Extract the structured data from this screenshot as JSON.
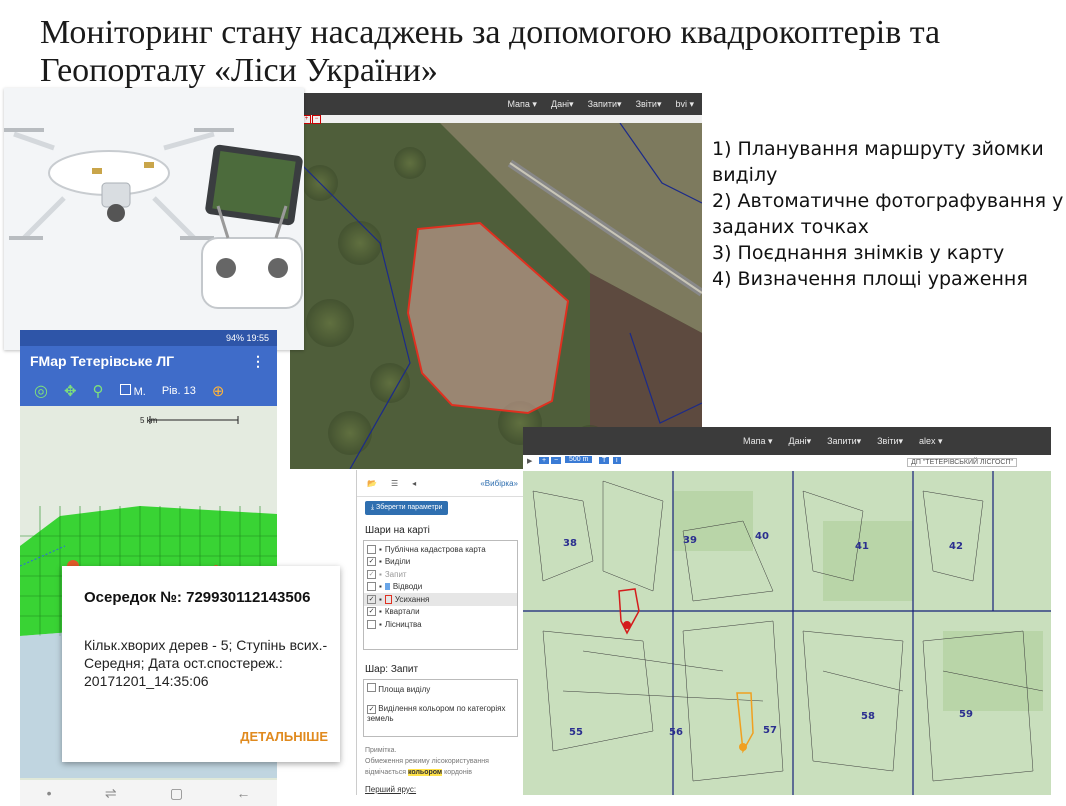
{
  "title": "Моніторинг стану насаджень за допомогою квадрокоптерів та Геопорталу «Ліси України»",
  "steps": [
    "1) Планування маршруту зйомки виділу",
    "2) Автоматичне фотографування у заданих точках",
    "3) Поєднання знімків у карту",
    "4) Визначення площі ураження"
  ],
  "geoportal_nav": {
    "items": [
      "Мапа ▾",
      "Дані▾",
      "Запити▾",
      "Звіти▾",
      "bvi ▾"
    ],
    "items2": [
      "Мапа ▾",
      "Дані▾",
      "Запити▾",
      "Звіти▾",
      "alex ▾"
    ]
  },
  "phone": {
    "status": "94% 19:55",
    "app_title": "FMap Тетерівське ЛГ",
    "check_label": "М.",
    "level": "Рів. 13",
    "scale": "5 km"
  },
  "popup": {
    "title": "Осередок №: 729930112143506",
    "body": "Кільк.хворих дерев - 5; Ступінь всих.- Середня; Дата ост.спостереж.: 20171201_14:35:06",
    "link": "ДЕТАЛЬНІШЕ"
  },
  "layers_panel": {
    "tab_selection": "«Вибірка»",
    "save_button": "Зберегти параметри",
    "heading": "Шари на карті",
    "items": [
      {
        "label": "Публічна кадастрова карта",
        "checked": false
      },
      {
        "label": "Виділи",
        "checked": true
      },
      {
        "label": "Запит",
        "checked": true
      },
      {
        "label": "Відводи",
        "checked": false
      },
      {
        "label": "Усихання",
        "checked": true
      },
      {
        "label": "Квартали",
        "checked": true
      },
      {
        "label": "Лісництва",
        "checked": false
      }
    ],
    "layer_heading": "Шар: Запит",
    "option1": "Площа виділу",
    "option2": "Виділення кольором по категоріях земель",
    "note_title": "Примітка.",
    "note_text": "Обмеження режиму лісокористування відмічається",
    "note_hl": "кольором",
    "note_tail": "кордонів",
    "storey": "Перший ярус:"
  },
  "map2": {
    "scale": "500 m",
    "org": "ДП \"ТЕТЕРІВСЬКИЙ ЛІСГОСП\"",
    "quarters": [
      "38",
      "39",
      "40",
      "41",
      "42",
      "55",
      "56",
      "57",
      "58",
      "59"
    ]
  },
  "colors": {
    "phone_bar": "#3f6cc9",
    "popup_link": "#e08a1e",
    "infection_outline": "#e03020",
    "grid_green": "#39d334"
  }
}
